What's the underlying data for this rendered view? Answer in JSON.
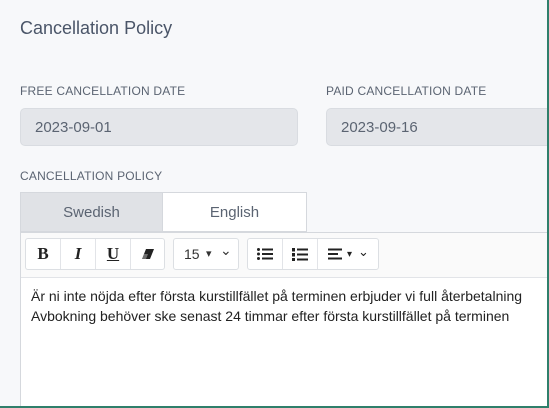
{
  "header": {
    "title": "Cancellation Policy"
  },
  "fields": {
    "free_label": "FREE CANCELLATION DATE",
    "free_value": "2023-09-01",
    "paid_label": "PAID CANCELLATION DATE",
    "paid_value": "2023-09-16",
    "policy_label": "CANCELLATION POLICY"
  },
  "tabs": [
    {
      "label": "Swedish",
      "active": true
    },
    {
      "label": "English",
      "active": false
    }
  ],
  "toolbar": {
    "bold": "B",
    "italic": "I",
    "underline": "U",
    "font_size": "15",
    "font_size_arrow": "▾",
    "chevron": "⌄"
  },
  "content": {
    "line1": "Är ni inte nöjda efter första kurstillfället på terminen erbjuder vi full återbetalning",
    "line2": "Avbokning behöver ske senast 24 timmar efter första kurstillfället på terminen"
  },
  "colors": {
    "frame_border": "#2f7f6b",
    "input_bg": "#e4e6ea",
    "tab_active_bg": "#e0e2e6"
  }
}
